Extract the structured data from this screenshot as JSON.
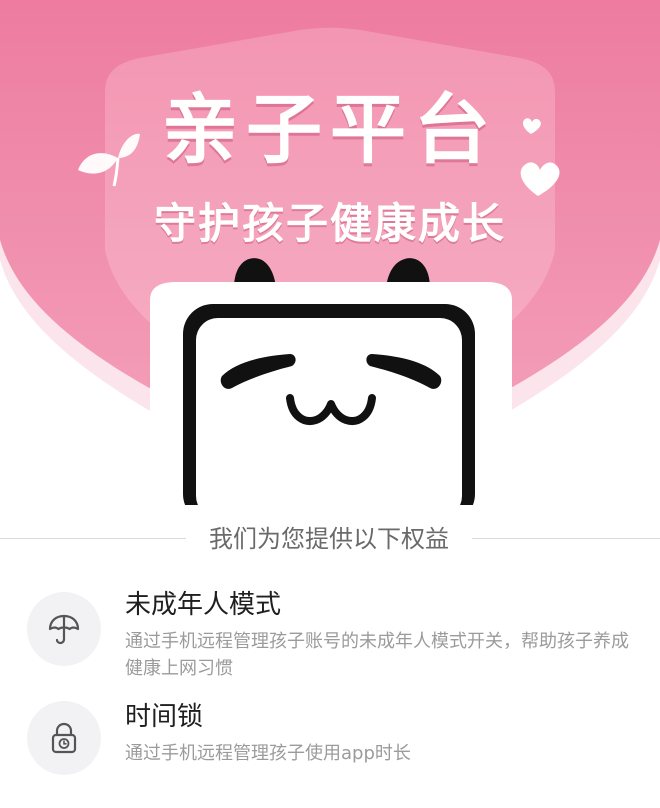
{
  "hero": {
    "title": "亲子平台",
    "subtitle": "守护孩子健康成长",
    "colors": {
      "background_top": "#ee7ea1",
      "background_bottom": "#f5a3bd",
      "shield_light": "#fbe3ea",
      "mascot_black": "#111111"
    }
  },
  "section": {
    "heading": "我们为您提供以下权益"
  },
  "benefits": [
    {
      "title": "未成年人模式",
      "description": "通过手机远程管理孩子账号的未成年人模式开关，帮助孩子养成健康上网习惯",
      "icon": "umbrella-icon"
    },
    {
      "title": "时间锁",
      "description": "通过手机远程管理孩子使用app时长",
      "icon": "clock-lock-icon"
    }
  ]
}
